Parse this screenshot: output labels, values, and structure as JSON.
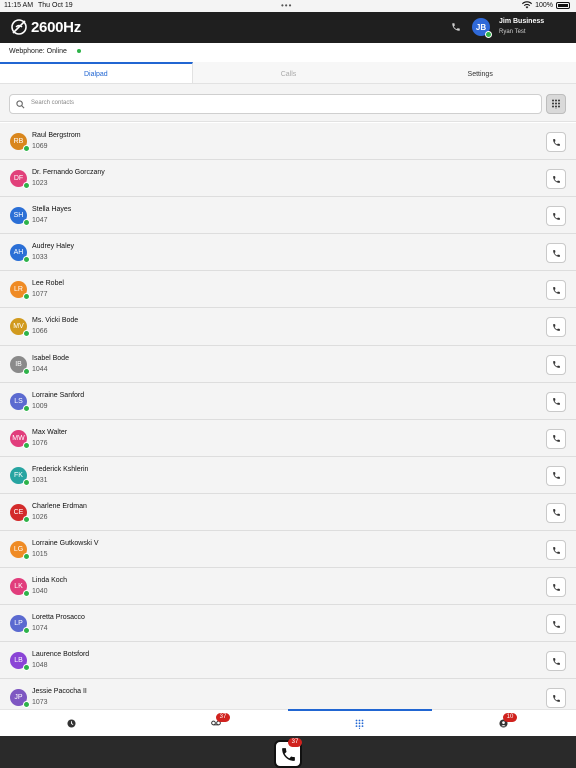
{
  "statusbar": {
    "time": "11:15 AM",
    "date": "Thu Oct 19",
    "battery": "100%"
  },
  "header": {
    "logo": "2600Hz",
    "user_initials": "JB",
    "user_name": "Jim Business",
    "user_sub": "Ryan Test"
  },
  "webphone": {
    "label": "Webphone: Online"
  },
  "tabs": [
    {
      "label": "Dialpad"
    },
    {
      "label": "Calls"
    },
    {
      "label": "Settings"
    }
  ],
  "search": {
    "placeholder": "Search contacts"
  },
  "contacts": [
    {
      "initials": "RB",
      "name": "Raul Bergstrom",
      "ext": "1069",
      "color": "#d9861c"
    },
    {
      "initials": "DF",
      "name": "Dr. Fernando Gorczany",
      "ext": "1023",
      "color": "#e1407a"
    },
    {
      "initials": "SH",
      "name": "Stella Hayes",
      "ext": "1047",
      "color": "#2b6fd6"
    },
    {
      "initials": "AH",
      "name": "Audrey Haley",
      "ext": "1033",
      "color": "#2b6fd6"
    },
    {
      "initials": "LR",
      "name": "Lee Robel",
      "ext": "1077",
      "color": "#ef8b25"
    },
    {
      "initials": "MV",
      "name": "Ms. Vicki Bode",
      "ext": "1066",
      "color": "#d19a1e"
    },
    {
      "initials": "IB",
      "name": "Isabel Bode",
      "ext": "1044",
      "color": "#8a8a8a"
    },
    {
      "initials": "LS",
      "name": "Lorraine Sanford",
      "ext": "1009",
      "color": "#5b6ad0"
    },
    {
      "initials": "MW",
      "name": "Max Walter",
      "ext": "1076",
      "color": "#e13d7c"
    },
    {
      "initials": "FK",
      "name": "Frederick Kshlerin",
      "ext": "1031",
      "color": "#27a4a1"
    },
    {
      "initials": "CE",
      "name": "Charlene Erdman",
      "ext": "1026",
      "color": "#d32b2b"
    },
    {
      "initials": "LG",
      "name": "Lorraine Gutkowski V",
      "ext": "1015",
      "color": "#ef8b25"
    },
    {
      "initials": "LK",
      "name": "Linda Koch",
      "ext": "1040",
      "color": "#e13d7c"
    },
    {
      "initials": "LP",
      "name": "Loretta Prosacco",
      "ext": "1074",
      "color": "#5b6ad0"
    },
    {
      "initials": "LB",
      "name": "Laurence Botsford",
      "ext": "1048",
      "color": "#8a44d6"
    },
    {
      "initials": "JP",
      "name": "Jessie Pacocha II",
      "ext": "1073",
      "color": "#7e57c2"
    }
  ],
  "tabbar": {
    "history_icon": "clock-icon",
    "voicemail_icon": "voicemail-icon",
    "voicemail_badge": "37",
    "dialpad_icon": "dialpad-icon",
    "contacts_icon": "contacts-icon",
    "contacts_badge": "10"
  },
  "dock": {
    "app_badge": "37"
  },
  "colors": {
    "accent": "#2166d2",
    "online": "#2fb34a",
    "badge": "#d0221e",
    "header_bg": "#1f1f1f"
  }
}
